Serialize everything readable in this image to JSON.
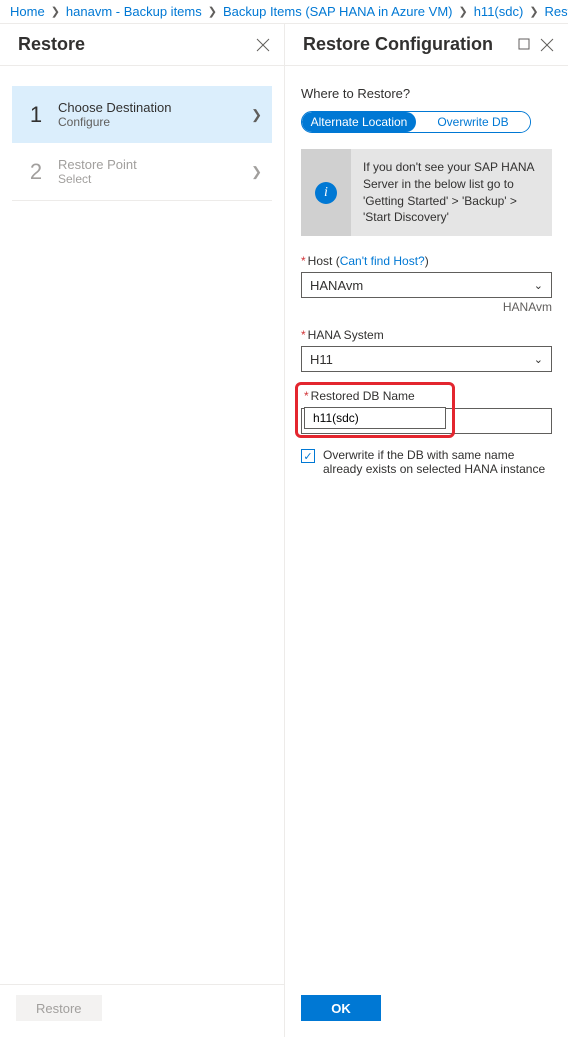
{
  "breadcrumb": {
    "items": [
      "Home",
      "hanavm - Backup items",
      "Backup Items (SAP HANA in Azure VM)",
      "h11(sdc)",
      "Restore"
    ],
    "truncated": "Re"
  },
  "left": {
    "title": "Restore",
    "steps": [
      {
        "num": "1",
        "title": "Choose Destination",
        "sub": "Configure"
      },
      {
        "num": "2",
        "title": "Restore Point",
        "sub": "Select"
      }
    ],
    "footer_btn": "Restore"
  },
  "right": {
    "title": "Restore Configuration",
    "where_label": "Where to Restore?",
    "toggle": {
      "alt": "Alternate Location",
      "overwrite": "Overwrite DB"
    },
    "info": "If you don't see your SAP HANA Server in the below list go to 'Getting Started' > 'Backup' > 'Start Discovery'",
    "host": {
      "label": "Host",
      "link": "Can't find Host?",
      "value": "HANAvm",
      "helper": "HANAvm"
    },
    "system": {
      "label": "HANA System",
      "value": "H11"
    },
    "dbname": {
      "label": "Restored DB Name",
      "value": "h11(sdc)"
    },
    "overwrite_check": "Overwrite if the DB with same name already exists on selected HANA instance",
    "ok_btn": "OK"
  }
}
